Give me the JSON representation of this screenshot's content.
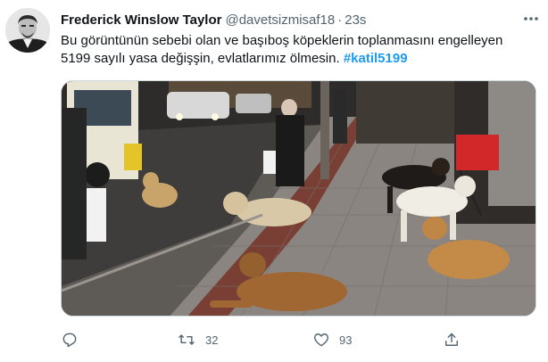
{
  "author": {
    "name": "Frederick Winslow Taylor",
    "handle": "@davetsizmisaf18",
    "separator": "·",
    "time": "23s"
  },
  "tweet": {
    "line1": "Bu görüntünün sebebi olan ve başıboş köpeklerin toplanmasını engelleyen",
    "line2_text": "5199 sayılı yasa değişşin, evlatlarımız ölmesin.",
    "hashtag": "#katil5199"
  },
  "media": {
    "description_icon": "street-photo-dogs"
  },
  "actions": {
    "reply": {
      "icon": "reply-icon",
      "count": ""
    },
    "retweet": {
      "icon": "retweet-icon",
      "count": "32"
    },
    "like": {
      "icon": "heart-icon",
      "count": "93"
    },
    "share": {
      "icon": "share-icon",
      "count": ""
    }
  },
  "colors": {
    "text": "#0f1419",
    "secondary": "#536471",
    "accent": "#1d9bf0"
  }
}
